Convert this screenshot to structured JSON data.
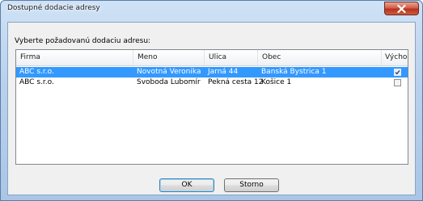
{
  "window": {
    "title": "Dostupné dodacie adresy"
  },
  "prompt": "Vyberte požadovanú dodaciu adresu:",
  "table": {
    "columns": [
      "Firma",
      "Meno",
      "Ulica",
      "Obec",
      "Východ..."
    ],
    "rows": [
      {
        "firma": "ABC s.r.o.",
        "meno": "Novotná Veronika",
        "ulica": "Jarná 44",
        "obec": "Banská Bystrica 1",
        "vychodzia": true,
        "selected": true
      },
      {
        "firma": "ABC s.r.o.",
        "meno": "Svoboda Lubomír",
        "ulica": "Pekná cesta 12",
        "obec": "Košice 1",
        "vychodzia": false,
        "selected": false
      }
    ]
  },
  "buttons": {
    "ok": "OK",
    "cancel": "Storno"
  },
  "colors": {
    "selection": "#3399ff",
    "close": "#c7432b",
    "frame": "#b9d1ec"
  }
}
